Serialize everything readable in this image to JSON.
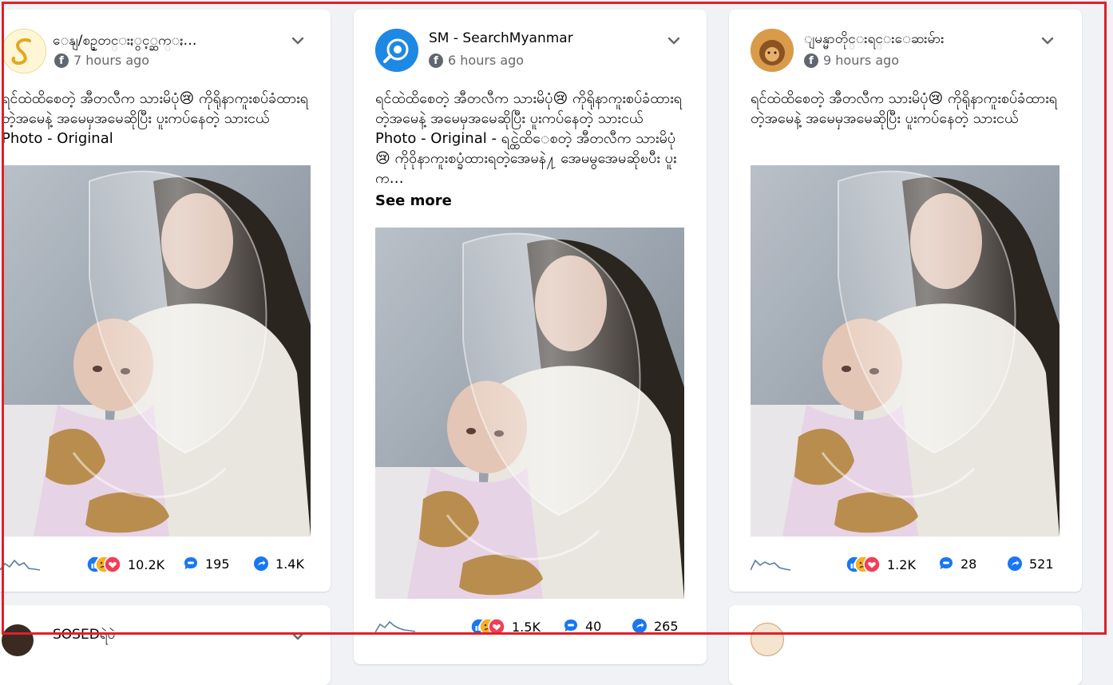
{
  "posts": [
    {
      "page_name": "ေနျ/စဥ္ဍတင္းႏွင့္ဆက္ႏ…",
      "time": "7 hours ago",
      "text": "ရင်ထဲထိစေတဲ့ အီတလီက သားမိပုံ😢 ကိုရိုနာကူးစပ်ခံထားရတဲ့အမေနဲ့ အမေမှအမေဆိုပြီး ပူးကပ်နေတဲ့ သားငယ် Photo - Original",
      "see_more": "",
      "reactions": "10.2K",
      "comments": "195",
      "shares": "1.4K"
    },
    {
      "page_name": "SM - SearchMyanmar",
      "time": "6 hours ago",
      "text": "ရင်ထဲထိစေတဲ့ အီတလီက သားမိပုံ😢 ကိုရိုနာကူးစပ်ခံထားရတဲ့အမေနဲ့ အမေမှအမေဆိုပြီး ပူးကပ်နေတဲ့ သားငယ် Photo - Original - ရင္ထဲထိေစတဲ့ အီတလီက သားမိပုံ😢 ကိုဝိုနာကူးစပ္ခံထားရတဲ့အေမနဲ႔ အေမမွအေမဆိုၿပီး ပူးက…",
      "see_more": "See more",
      "reactions": "1.5K",
      "comments": "40",
      "shares": "265"
    },
    {
      "page_name": "ျမန္မာတိုင္းရင္းေဆးမ်ား",
      "time": "9 hours ago",
      "text": "ရင်ထဲထိစေတဲ့ အီတလီက သားမိပုံ😢 ကိုရိုနာကူးစပ်ခံထားရတဲ့အမေနဲ့ အမေမှအမေဆိုပြီး ပူးကပ်နေတဲ့ သားငယ်",
      "see_more": "",
      "reactions": "1.2K",
      "comments": "28",
      "shares": "521"
    }
  ],
  "bottom_cards": [
    {
      "page_name": "SOSEDရဲပဲ"
    },
    {
      "page_name": ""
    }
  ],
  "icons": {
    "options": "chevron-down-icon",
    "platform": "facebook-icon",
    "comment": "comment-icon",
    "share": "share-icon",
    "reactions": "reactions-icon"
  },
  "colors": {
    "border_highlight": "#e0202a",
    "background": "#f0f2f5",
    "icon_blue": "#1877f2"
  }
}
